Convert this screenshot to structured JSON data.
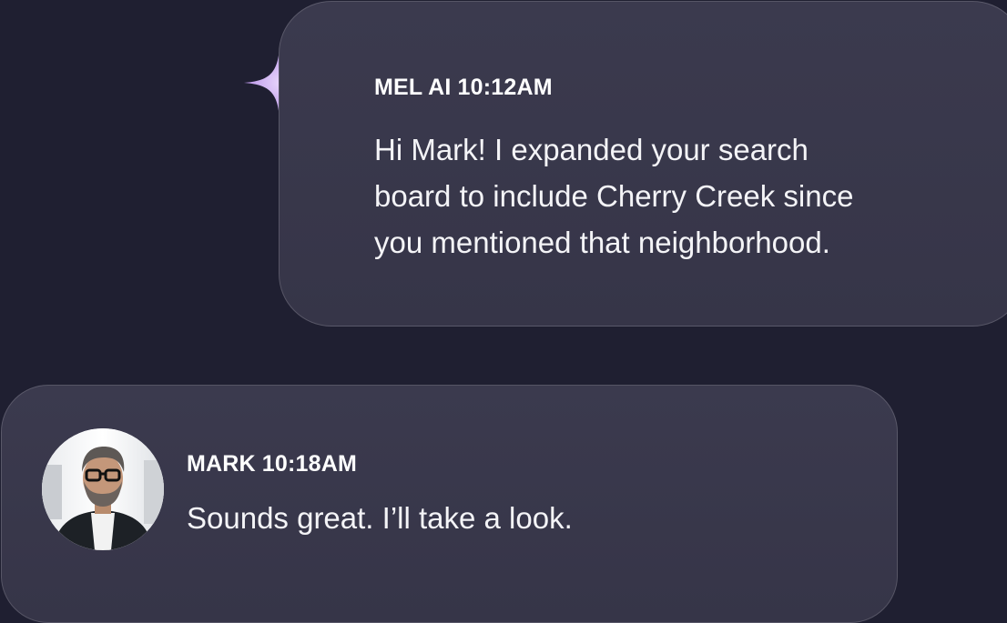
{
  "messages": [
    {
      "sender": "MEL AI",
      "time": "10:12AM",
      "lines": [
        "Hi Mark! I expanded your search",
        "board to include Cherry Creek since",
        "you mentioned that neighborhood."
      ],
      "icon": "sparkle-icon"
    },
    {
      "sender": "MARK",
      "time": "10:18AM",
      "lines": [
        "Sounds great. I’ll take a look."
      ],
      "icon": "avatar"
    }
  ],
  "colors": {
    "background": "#1f1f31",
    "bubble": "#39384c",
    "sparkle": "#c7a6ec"
  }
}
